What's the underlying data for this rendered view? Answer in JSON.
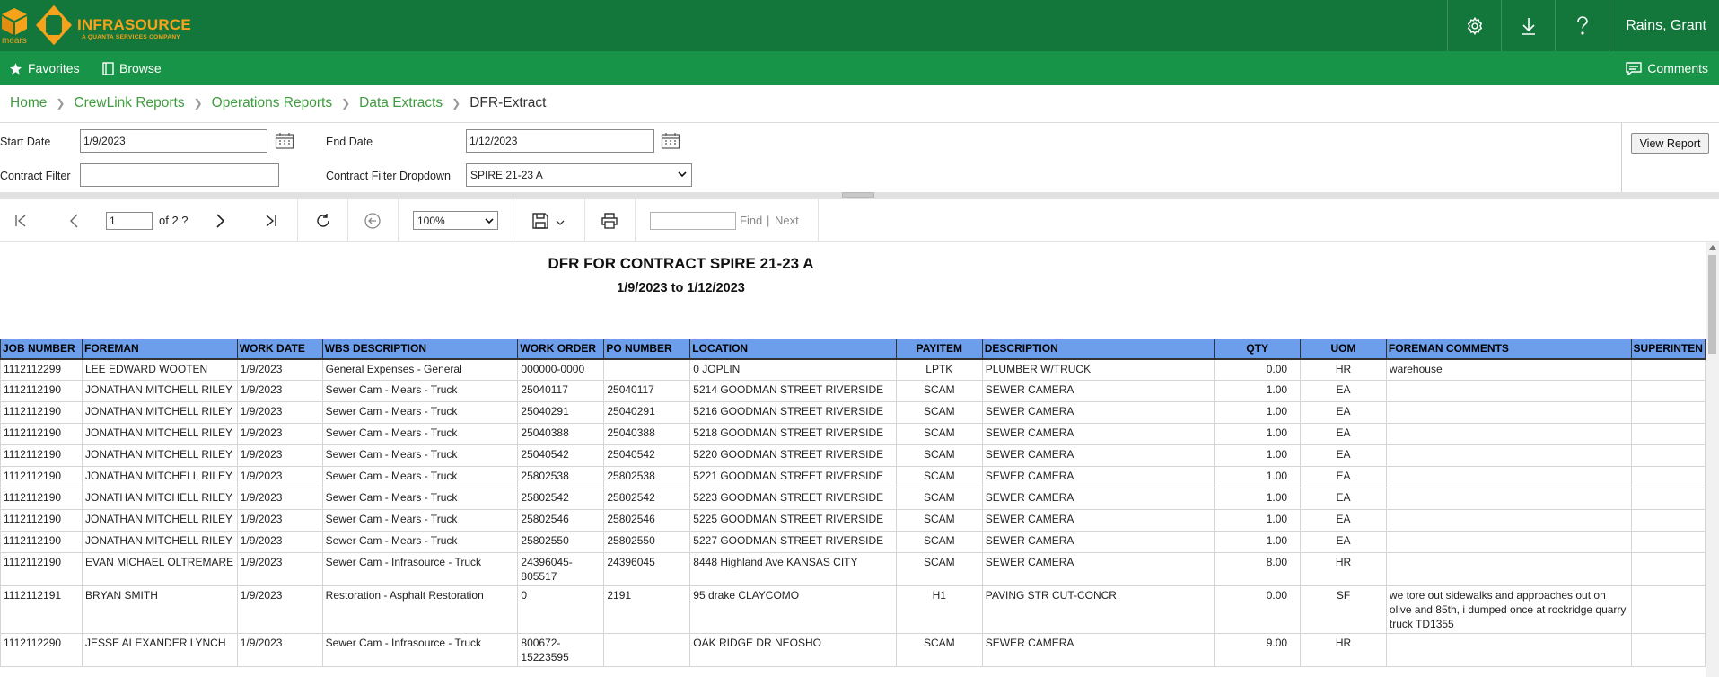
{
  "header": {
    "brand": "INFRASOURCE",
    "tagline": "A QUANTA SERVICES COMPANY",
    "mears": "mears",
    "user": "Rains, Grant"
  },
  "nav": {
    "favorites": "Favorites",
    "browse": "Browse",
    "comments": "Comments"
  },
  "breadcrumb": {
    "items": [
      "Home",
      "CrewLink Reports",
      "Operations Reports",
      "Data Extracts"
    ],
    "current": "DFR-Extract"
  },
  "params": {
    "start_date_label": "Start Date",
    "start_date_value": "1/9/2023",
    "end_date_label": "End Date",
    "end_date_value": "1/12/2023",
    "contract_filter_label": "Contract Filter",
    "contract_filter_value": "",
    "dropdown_label": "Contract Filter Dropdown",
    "dropdown_value": "SPIRE 21-23 A",
    "view_report": "View Report"
  },
  "toolbar": {
    "page": "1",
    "of_pages": "of 2 ?",
    "zoom": "100%",
    "find": "Find",
    "next": "Next"
  },
  "report": {
    "title": "DFR FOR CONTRACT SPIRE 21-23 A",
    "subtitle": "1/9/2023 to 1/12/2023",
    "columns": [
      "JOB NUMBER",
      "FOREMAN",
      "WORK DATE",
      "WBS DESCRIPTION",
      "WORK ORDER",
      "PO NUMBER",
      "LOCATION",
      "PAYITEM",
      "DESCRIPTION",
      "QTY",
      "UOM",
      "FOREMAN COMMENTS",
      "SUPERINTEN"
    ],
    "rows": [
      [
        "1112112299",
        "LEE EDWARD WOOTEN",
        "1/9/2023",
        "General Expenses - General",
        "000000-0000",
        "",
        "0 JOPLIN",
        "LPTK",
        "PLUMBER W/TRUCK",
        "0.00",
        "HR",
        "warehouse",
        ""
      ],
      [
        "1112112190",
        "JONATHAN MITCHELL RILEY",
        "1/9/2023",
        "Sewer Cam - Mears - Truck",
        "25040117",
        "25040117",
        "5214 GOODMAN STREET RIVERSIDE",
        "SCAM",
        "SEWER CAMERA",
        "1.00",
        "EA",
        "",
        ""
      ],
      [
        "1112112190",
        "JONATHAN MITCHELL RILEY",
        "1/9/2023",
        "Sewer Cam - Mears - Truck",
        "25040291",
        "25040291",
        "5216 GOODMAN STREET RIVERSIDE",
        "SCAM",
        "SEWER CAMERA",
        "1.00",
        "EA",
        "",
        ""
      ],
      [
        "1112112190",
        "JONATHAN MITCHELL RILEY",
        "1/9/2023",
        "Sewer Cam - Mears - Truck",
        "25040388",
        "25040388",
        "5218 GOODMAN STREET RIVERSIDE",
        "SCAM",
        "SEWER CAMERA",
        "1.00",
        "EA",
        "",
        ""
      ],
      [
        "1112112190",
        "JONATHAN MITCHELL RILEY",
        "1/9/2023",
        "Sewer Cam - Mears - Truck",
        "25040542",
        "25040542",
        "5220 GOODMAN STREET RIVERSIDE",
        "SCAM",
        "SEWER CAMERA",
        "1.00",
        "EA",
        "",
        ""
      ],
      [
        "1112112190",
        "JONATHAN MITCHELL RILEY",
        "1/9/2023",
        "Sewer Cam - Mears - Truck",
        "25802538",
        "25802538",
        "5221 GOODMAN STREET RIVERSIDE",
        "SCAM",
        "SEWER CAMERA",
        "1.00",
        "EA",
        "",
        ""
      ],
      [
        "1112112190",
        "JONATHAN MITCHELL RILEY",
        "1/9/2023",
        "Sewer Cam - Mears - Truck",
        "25802542",
        "25802542",
        "5223 GOODMAN STREET RIVERSIDE",
        "SCAM",
        "SEWER CAMERA",
        "1.00",
        "EA",
        "",
        ""
      ],
      [
        "1112112190",
        "JONATHAN MITCHELL RILEY",
        "1/9/2023",
        "Sewer Cam - Mears - Truck",
        "25802546",
        "25802546",
        "5225 GOODMAN STREET RIVERSIDE",
        "SCAM",
        "SEWER CAMERA",
        "1.00",
        "EA",
        "",
        ""
      ],
      [
        "1112112190",
        "JONATHAN MITCHELL RILEY",
        "1/9/2023",
        "Sewer Cam - Mears - Truck",
        "25802550",
        "25802550",
        "5227 GOODMAN STREET RIVERSIDE",
        "SCAM",
        "SEWER CAMERA",
        "1.00",
        "EA",
        "",
        ""
      ],
      [
        "1112112190",
        "EVAN MICHAEL OLTREMARE",
        "1/9/2023",
        "Sewer Cam - Infrasource - Truck",
        "24396045-805517",
        "24396045",
        "8448 Highland Ave KANSAS CITY",
        "SCAM",
        "SEWER CAMERA",
        "8.00",
        "HR",
        "",
        ""
      ],
      [
        "1112112191",
        "BRYAN SMITH",
        "1/9/2023",
        "Restoration - Asphalt Restoration",
        "0",
        "2191",
        "95 drake CLAYCOMO",
        "H1",
        "PAVING STR CUT-CONCR",
        "0.00",
        "SF",
        "we tore out sidewalks and approaches out on olive and 85th, i dumped once at rockridge quarry truck TD1355",
        ""
      ],
      [
        "1112112290",
        "JESSE ALEXANDER LYNCH",
        "1/9/2023",
        "Sewer Cam - Infrasource - Truck",
        "800672-15223595",
        "",
        "OAK RIDGE DR NEOSHO",
        "SCAM",
        "SEWER CAMERA",
        "9.00",
        "HR",
        "",
        ""
      ]
    ]
  }
}
